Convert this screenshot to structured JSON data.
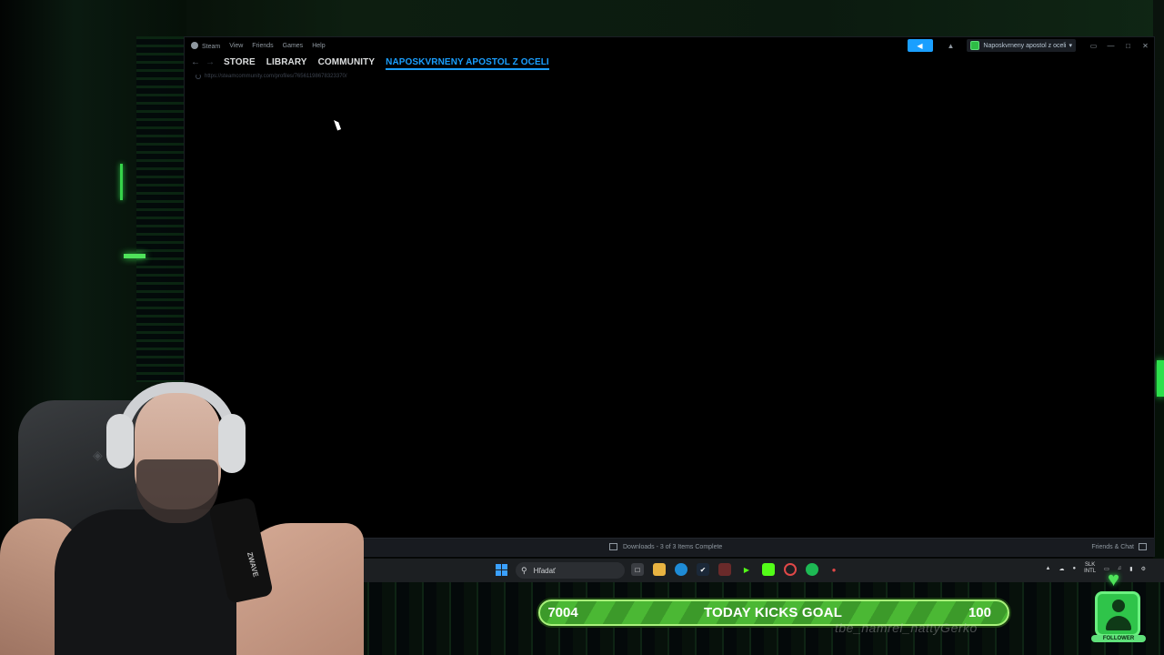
{
  "steam": {
    "menu": [
      "Steam",
      "View",
      "Friends",
      "Games",
      "Help"
    ],
    "nav_tabs": [
      "STORE",
      "LIBRARY",
      "COMMUNITY"
    ],
    "active_tab": "NAPOSKVRNENY APOSTOL Z OCELI",
    "url": "https://steamcommunity.com/profiles/76561198678323370/",
    "username": "Naposkvrneny apostol z oceli",
    "downloads_status": "Downloads - 3 of 3 Items Complete",
    "friends_chat": "Friends & Chat",
    "accent_color": "#1a9fff"
  },
  "taskbar": {
    "search_placeholder": "Hľadať",
    "lang_top": "SLK",
    "lang_bottom": "INTL"
  },
  "overlay": {
    "goal_current": "7004",
    "goal_title": "TODAY KICKS GOAL",
    "goal_target": "100",
    "chat_text": "tbe_namrel_nattyGerko",
    "follower_label": "FOLLOWER",
    "mic_brand": "ZWAVE"
  }
}
